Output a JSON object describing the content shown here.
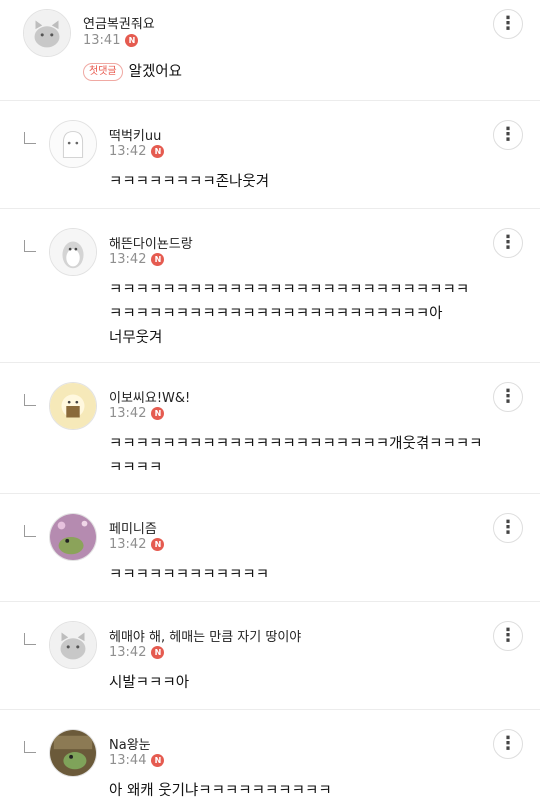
{
  "comments": [
    {
      "author": "연금복권줘요",
      "time": "13:41",
      "badge": "N",
      "first_label": "첫댓글",
      "lines": [
        "알겠어요"
      ],
      "avatar": "gray-cat-avatar"
    },
    {
      "author": "떡벅키uu",
      "time": "13:42",
      "badge": "N",
      "lines": [
        "ㅋㅋㅋㅋㅋㅋㅋㅋ존나웃겨"
      ],
      "avatar": "white-ghost-avatar"
    },
    {
      "author": "해뜬다이뇬드랑",
      "time": "13:42",
      "badge": "N",
      "lines": [
        "ㅋㅋㅋㅋㅋㅋㅋㅋㅋㅋㅋㅋㅋㅋㅋㅋㅋㅋㅋㅋㅋㅋㅋㅋㅋㅋㅋ",
        "ㅋㅋㅋㅋㅋㅋㅋㅋㅋㅋㅋㅋㅋㅋㅋㅋㅋㅋㅋㅋㅋㅋㅋㅋ아",
        "너무웃겨"
      ],
      "avatar": "penguin-avatar"
    },
    {
      "author": "이보씨요!W&!",
      "time": "13:42",
      "badge": "N",
      "lines": [
        "ㅋㅋㅋㅋㅋㅋㅋㅋㅋㅋㅋㅋㅋㅋㅋㅋㅋㅋㅋㅋㅋ개웃겪ㅋㅋㅋㅋ",
        "ㅋㅋㅋㅋ"
      ],
      "avatar": "bear-photo-avatar"
    },
    {
      "author": "페미니즘",
      "time": "13:42",
      "badge": "N",
      "lines": [
        "ㅋㅋㅋㅋㅋㅋㅋㅋㅋㅋㅋㅋ"
      ],
      "avatar": "frog-photo-avatar"
    },
    {
      "author": "헤매야 해, 헤매는 만큼 자기 땅이야",
      "time": "13:42",
      "badge": "N",
      "lines": [
        "시발ㅋㅋㅋ아"
      ],
      "avatar": "gray-cat-avatar"
    },
    {
      "author": "Na왕눈",
      "time": "13:44",
      "badge": "N",
      "lines": [
        "아 왜캐 웃기냐ㅋㅋㅋㅋㅋㅋㅋㅋㅋㅋ"
      ],
      "avatar": "frog-photo-avatar-2"
    }
  ],
  "more_icon": "⋮"
}
